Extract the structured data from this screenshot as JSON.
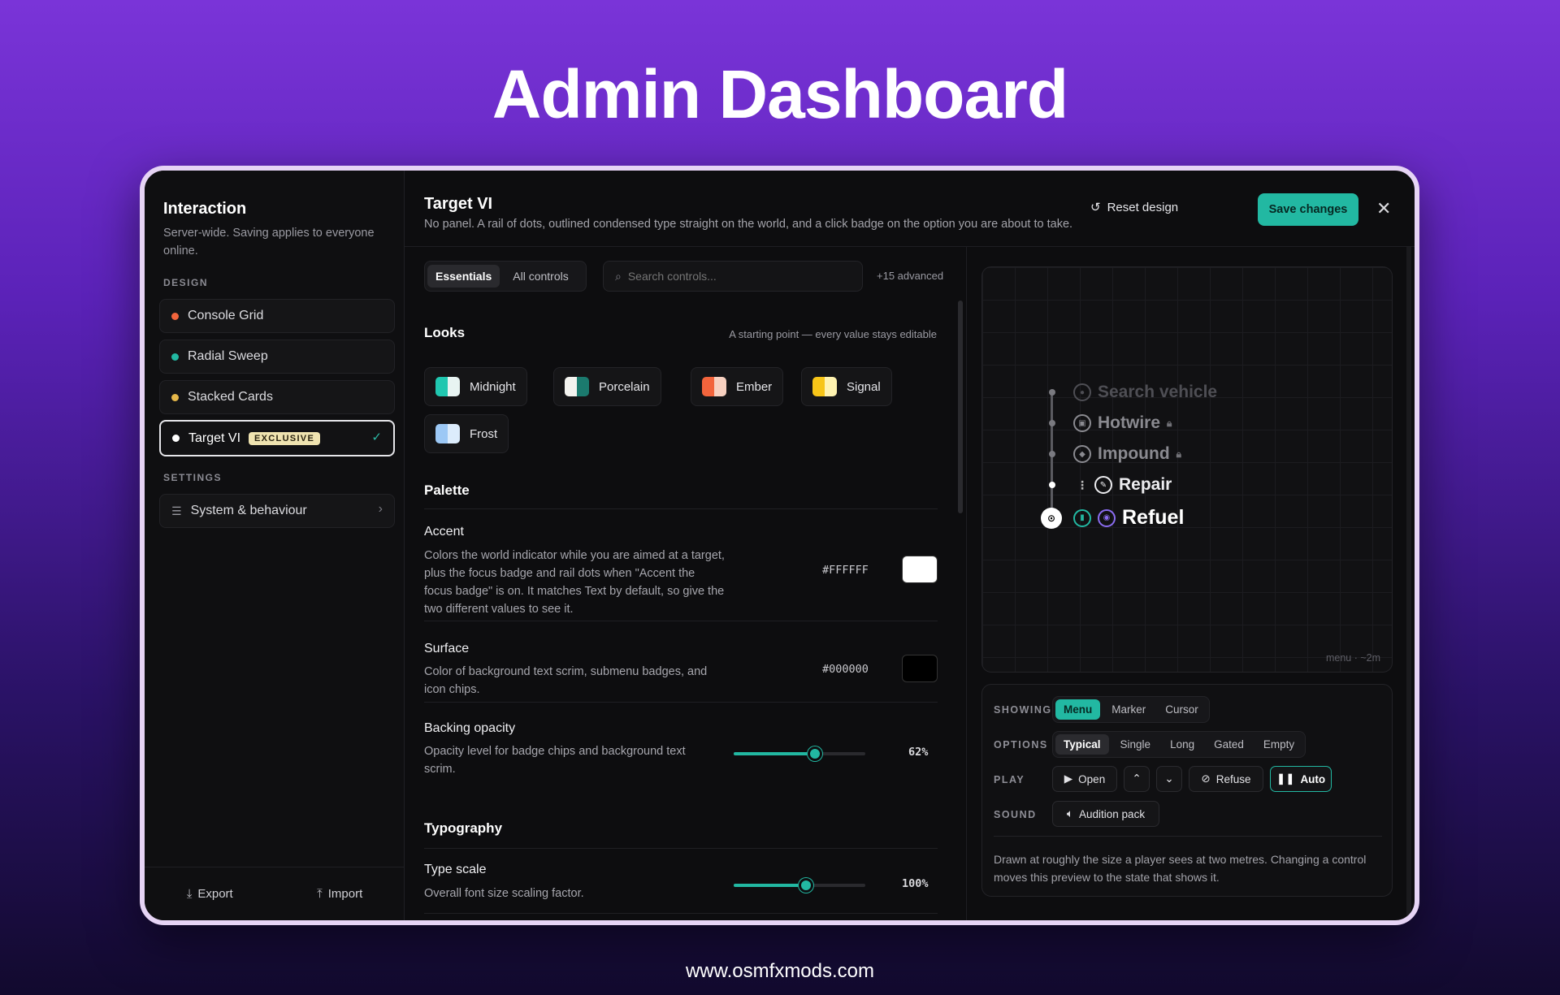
{
  "hero": {
    "title": "Admin Dashboard",
    "footer_url": "www.osmfxmods.com"
  },
  "sidebar": {
    "title": "Interaction",
    "subtitle": "Server-wide. Saving applies to everyone online.",
    "design_label": "DESIGN",
    "settings_label": "SETTINGS",
    "designs": [
      {
        "label": "Console Grid",
        "dot": "#f2643c"
      },
      {
        "label": "Radial Sweep",
        "dot": "#22b8a2"
      },
      {
        "label": "Stacked Cards",
        "dot": "#e6b84a"
      },
      {
        "label": "Target VI",
        "dot": "#ffffff",
        "badge": "EXCLUSIVE"
      }
    ],
    "settings_item": "System & behaviour",
    "export_label": "Export",
    "import_label": "Import"
  },
  "header": {
    "title": "Target VI",
    "subtitle": "No panel. A rail of dots, outlined condensed type straight on the world, and a click badge on the option you are about to take.",
    "reset_label": "Reset design",
    "save_label": "Save changes"
  },
  "toolbar": {
    "tab_essentials": "Essentials",
    "tab_all": "All controls",
    "search_placeholder": "Search controls...",
    "advanced_count": "+15 advanced"
  },
  "looks": {
    "title": "Looks",
    "note": "A starting point — every value stays editable",
    "presets": [
      {
        "label": "Midnight",
        "colors": [
          "#20c7b0",
          "#e8f4f2"
        ]
      },
      {
        "label": "Porcelain",
        "colors": [
          "#f3f3ef",
          "#1b7a6e"
        ]
      },
      {
        "label": "Ember",
        "colors": [
          "#f2643c",
          "#f7d0c0"
        ]
      },
      {
        "label": "Signal",
        "colors": [
          "#f7c518",
          "#fff3b0"
        ]
      },
      {
        "label": "Frost",
        "colors": [
          "#9cc8f5",
          "#dcecfc"
        ]
      }
    ]
  },
  "palette": {
    "title": "Palette",
    "accent_label": "Accent",
    "accent_desc": "Colors the world indicator while you are aimed at a target, plus the focus badge and rail dots when \"Accent the focus badge\" is on. It matches Text by default, so give the two different values to see it.",
    "accent_hex": "#FFFFFF",
    "accent_color": "#ffffff",
    "surface_label": "Surface",
    "surface_desc": "Color of background text scrim, submenu badges, and icon chips.",
    "surface_hex": "#000000",
    "surface_color": "#000000",
    "opacity_label": "Backing opacity",
    "opacity_desc": "Opacity level for badge chips and background text scrim.",
    "opacity_value": "62%",
    "opacity_fraction": 0.62
  },
  "typography": {
    "title": "Typography",
    "scale_label": "Type scale",
    "scale_desc": "Overall font size scaling factor.",
    "scale_value": "100%",
    "scale_fraction": 0.55
  },
  "preview": {
    "items": [
      {
        "label": "Search vehicle",
        "state": "faded"
      },
      {
        "label": "Hotwire",
        "state": "locked"
      },
      {
        "label": "Impound",
        "state": "locked"
      },
      {
        "label": "Repair",
        "state": "normal"
      },
      {
        "label": "Refuel",
        "state": "focused"
      }
    ],
    "caption": "menu · ~2m"
  },
  "controls": {
    "showing_label": "SHOWING",
    "showing": [
      "Menu",
      "Marker",
      "Cursor"
    ],
    "options_label": "OPTIONS",
    "options": [
      "Typical",
      "Single",
      "Long",
      "Gated",
      "Empty"
    ],
    "play_label": "PLAY",
    "open_label": "Open",
    "refuse_label": "Refuse",
    "auto_label": "Auto",
    "sound_label": "SOUND",
    "audition_label": "Audition pack",
    "note": "Drawn at roughly the size a player sees at two metres. Changing a control moves this preview to the state that shows it."
  }
}
